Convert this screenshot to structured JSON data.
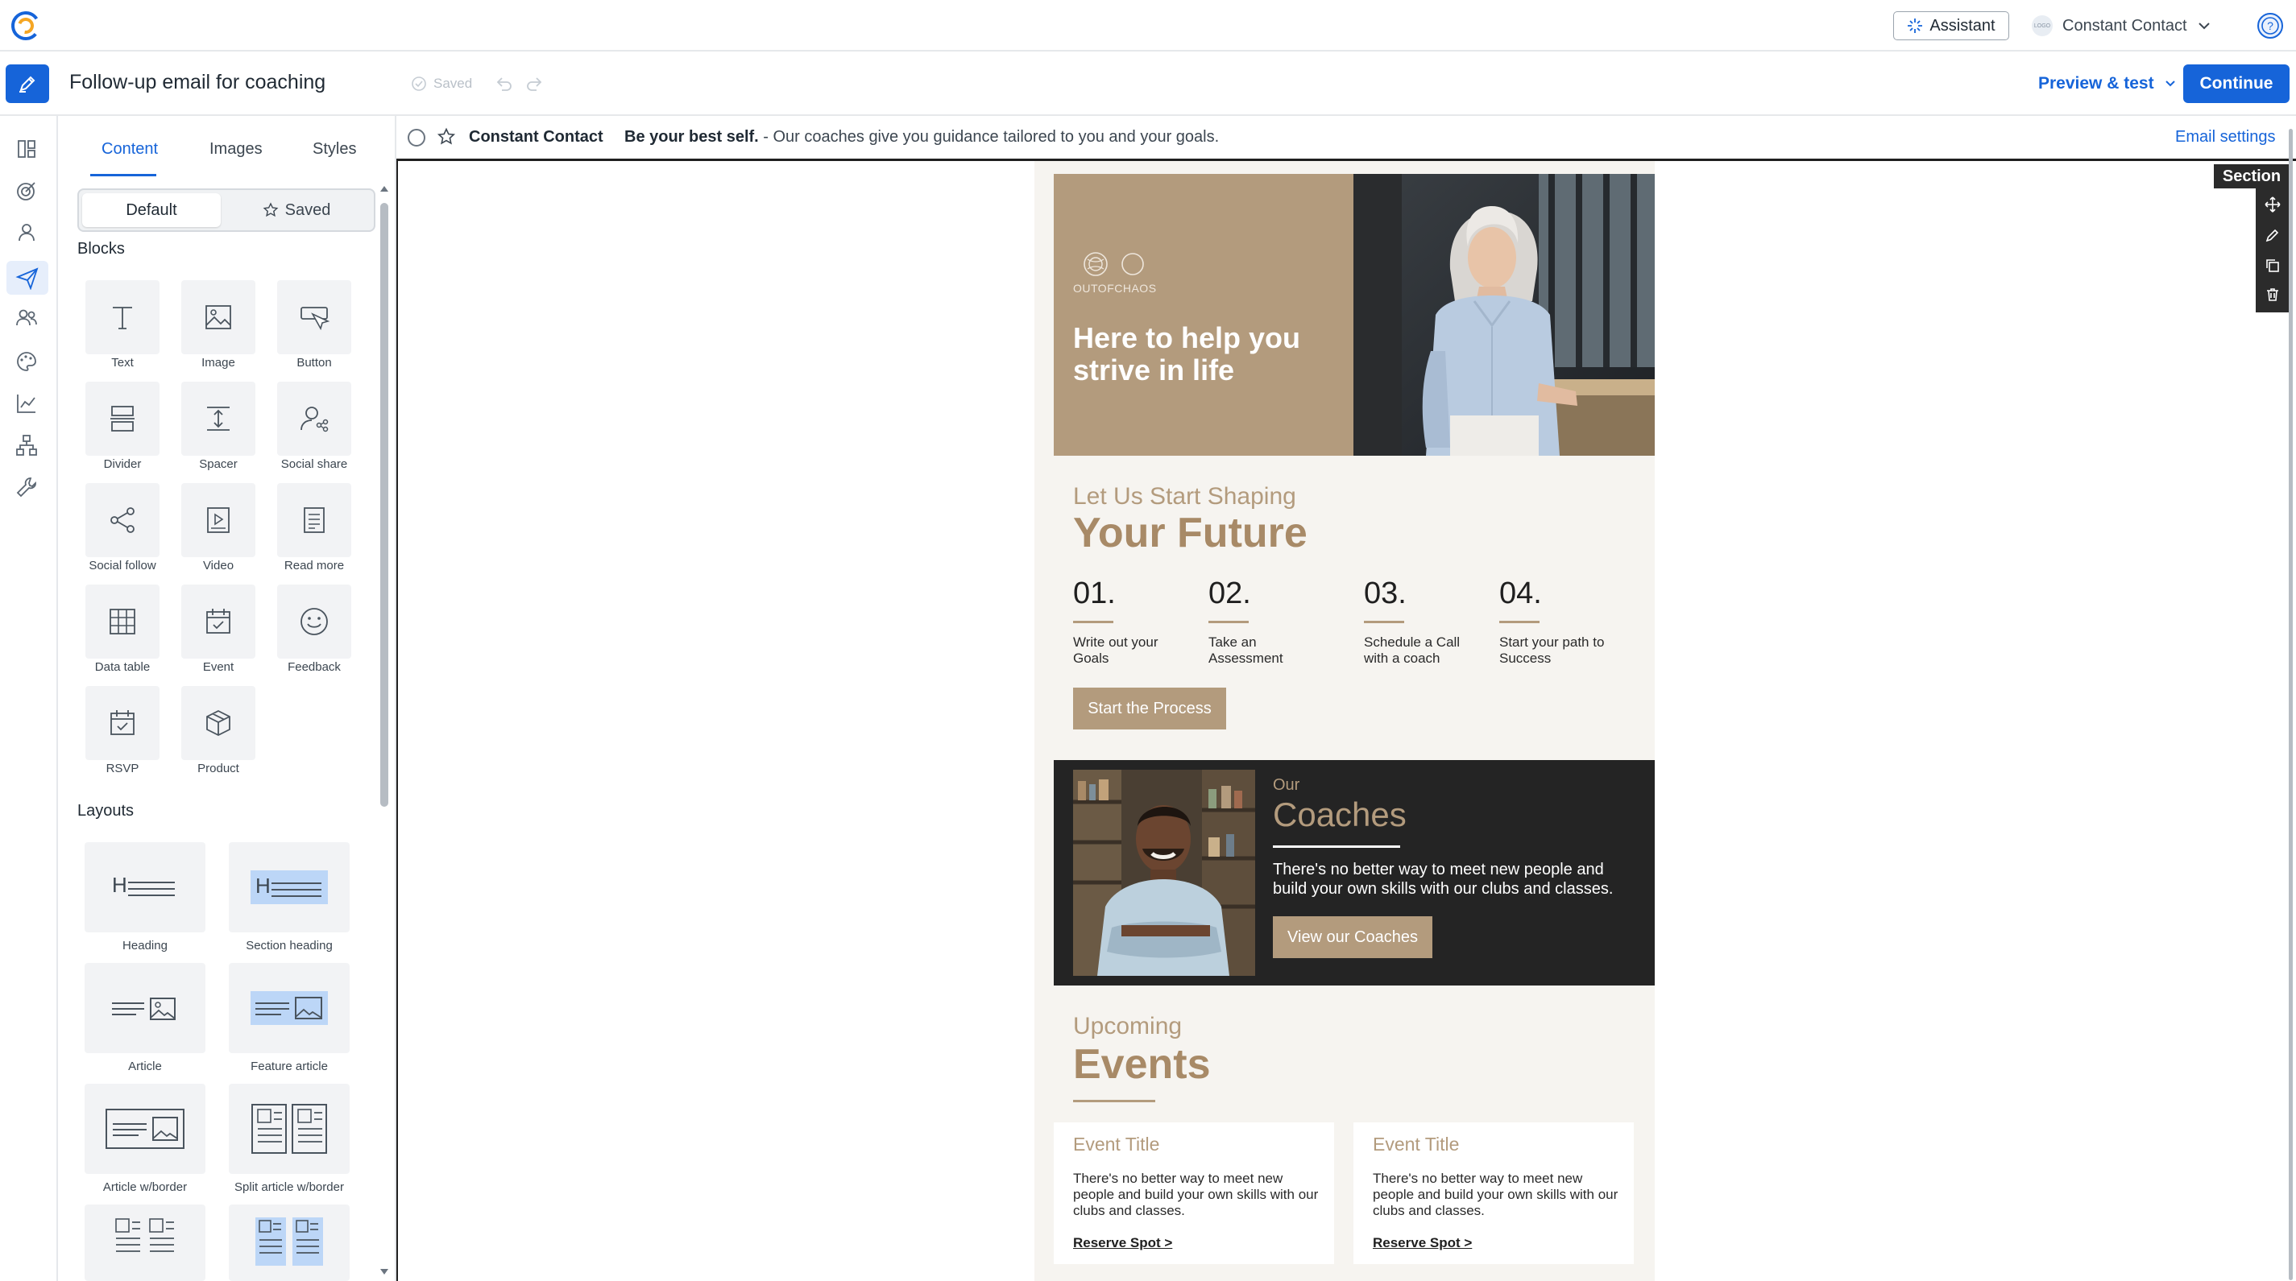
{
  "topbar": {
    "assistant_label": "Assistant",
    "account_badge": "LOGO",
    "account_name": "Constant Contact"
  },
  "toolbar": {
    "title": "Follow-up email for coaching",
    "saved_label": "Saved",
    "preview_label": "Preview & test",
    "continue_label": "Continue"
  },
  "panel": {
    "tabs": [
      "Content",
      "Images",
      "Styles"
    ],
    "segment": {
      "default_label": "Default",
      "saved_label": "Saved"
    },
    "blocks_heading": "Blocks",
    "blocks": [
      "Text",
      "Image",
      "Button",
      "Divider",
      "Spacer",
      "Social share",
      "Social follow",
      "Video",
      "Read more",
      "Data table",
      "Event",
      "Feedback",
      "RSVP",
      "Product"
    ],
    "layouts_heading": "Layouts",
    "layouts": [
      "Heading",
      "Section heading",
      "Article",
      "Feature article",
      "Article w/border",
      "Split article w/border"
    ]
  },
  "subject": {
    "from": "Constant Contact",
    "subject_bold": "Be your best self.",
    "preheader": " - Our coaches give you guidance tailored to you and your goals.",
    "settings_label": "Email settings"
  },
  "email": {
    "hero": {
      "logo_text": "OUTOFCHAOS",
      "headline": "Here to help you strive in life"
    },
    "intro": {
      "kicker": "Let Us Start Shaping",
      "title": "Your Future"
    },
    "steps": [
      {
        "num": "01.",
        "text": "Write out your Goals"
      },
      {
        "num": "02.",
        "text": "Take an Assessment"
      },
      {
        "num": "03.",
        "text": "Schedule a Call with a coach"
      },
      {
        "num": "04.",
        "text": "Start your path to Success"
      }
    ],
    "start_button": "Start the Process",
    "coaches": {
      "kicker": "Our",
      "title": "Coaches",
      "text": "There's no better way to meet new people and build your own skills with our clubs and classes.",
      "button": "View our Coaches"
    },
    "events": {
      "kicker": "Upcoming",
      "title": "Events",
      "cards": [
        {
          "title": "Event Title",
          "text": "There's no better way to meet new people and build your own skills with our clubs and classes.",
          "link": "Reserve Spot >"
        },
        {
          "title": "Event Title",
          "text": "There's no better way to meet new people and build your own skills with our clubs and classes.",
          "link": "Reserve Spot >"
        }
      ]
    }
  },
  "section_toolbar": {
    "label": "Section"
  },
  "colors": {
    "accent": "#1664d9",
    "tan": "#b39b7d",
    "dark": "#242424",
    "cream": "#f6f4f0"
  }
}
